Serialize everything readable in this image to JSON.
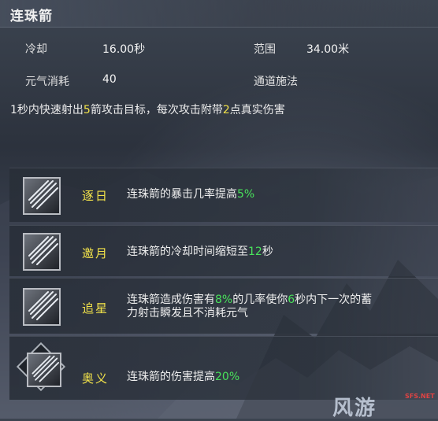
{
  "skill": {
    "title": "连珠箭",
    "stats": {
      "cooldown_label": "冷却",
      "cooldown_value": "16.00秒",
      "range_label": "范围",
      "range_value": "34.00米",
      "cost_label": "元气消耗",
      "cost_value": "40",
      "cast_type": "通道施法"
    },
    "description": {
      "p1": "1秒内快速射出",
      "n1": "5",
      "p2": "箭攻击目标，每次攻击附带",
      "n2": "2",
      "p3": "点真实伤害"
    }
  },
  "upgrades": [
    {
      "name": "逐日",
      "icon": "arrow-volley-icon",
      "text_a": "连珠箭的暴击几率提高",
      "value_a": "5%"
    },
    {
      "name": "邀月",
      "icon": "arrow-volley-icon",
      "text_a": "连珠箭的冷却时间缩短至",
      "value_a": "12",
      "text_b": "秒"
    },
    {
      "name": "追星",
      "icon": "arrow-volley-icon",
      "text_a": "连珠箭造成伤害有",
      "value_a": "8%",
      "text_b": "的几率使你",
      "value_b": "6",
      "text_c": "秒内下一次的蓄",
      "text_d": "力射击瞬发且不消耗元气"
    },
    {
      "name": "奥义",
      "icon": "arrow-volley-icon",
      "text_a": "连珠箭的伤害提高",
      "value_a": "20%"
    }
  ],
  "watermark": {
    "main": "风游",
    "sub": "SFS.NET"
  },
  "colors": {
    "highlight_yellow": "#f2e24a",
    "highlight_green": "#49e35b"
  }
}
